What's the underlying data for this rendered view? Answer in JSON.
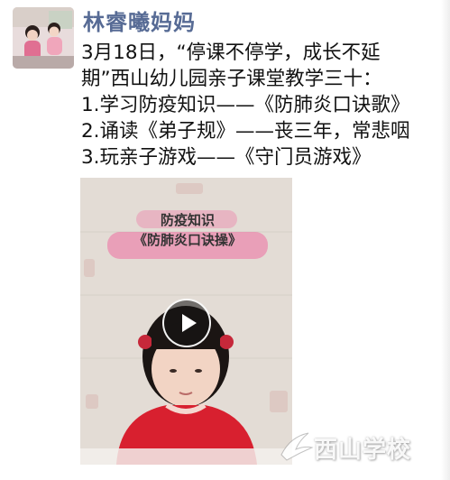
{
  "post": {
    "author": "林睿曦妈妈",
    "content_lines": [
      "3月18日，“停课不停学，成长不延",
      "期”西山幼儿园亲子课堂教学三十：",
      "1.学习防疫知识——《防肺炎口诀歌》",
      "2.诵读《弟子规》——丧三年，常悲咽",
      "3.玩亲子游戏——《守门员游戏》"
    ]
  },
  "video": {
    "banner_line1": "防疫知识",
    "banner_line2": "《防肺炎口诀操》",
    "play_icon": "play-icon",
    "watermark": "西山学校"
  },
  "colors": {
    "author_name": "#576b95",
    "text": "#111111",
    "banner_highlight": "#ee6ea0",
    "child_clothing": "#d8202f",
    "wall": "#ddd6cf"
  }
}
